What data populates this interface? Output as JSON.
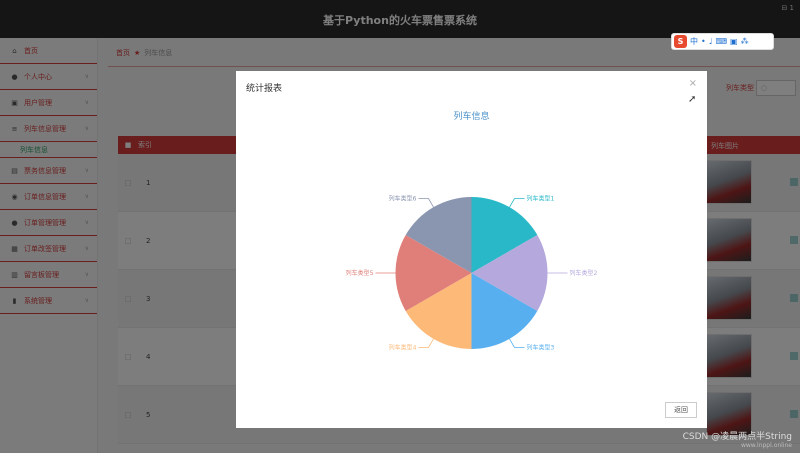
{
  "app": {
    "title": "基于Python的火车票售票系统",
    "top_right": "⊟ 1"
  },
  "sidebar": {
    "items": [
      {
        "label": "首页",
        "icon": "home-icon",
        "glyph": "⌂",
        "chevron": ""
      },
      {
        "label": "个人中心",
        "icon": "user-icon",
        "glyph": "●",
        "chevron": "∨"
      },
      {
        "label": "用户管理",
        "icon": "id-card-icon",
        "glyph": "▣",
        "chevron": "∨"
      },
      {
        "label": "列车信息管理",
        "icon": "list-icon",
        "glyph": "≡",
        "chevron": "∨"
      },
      {
        "label": "列车信息",
        "sub": true
      },
      {
        "label": "票务信息管理",
        "icon": "ticket-icon",
        "glyph": "▤",
        "chevron": "∨"
      },
      {
        "label": "订单信息管理",
        "icon": "lightbulb-icon",
        "glyph": "◉",
        "chevron": "∨"
      },
      {
        "label": "订单管理管理",
        "icon": "person-icon",
        "glyph": "●",
        "chevron": "∨"
      },
      {
        "label": "订单改签管理",
        "icon": "calendar-icon",
        "glyph": "▦",
        "chevron": "∨"
      },
      {
        "label": "留言板管理",
        "icon": "message-icon",
        "glyph": "▥",
        "chevron": "∨"
      },
      {
        "label": "系统管理",
        "icon": "chart-icon",
        "glyph": "▮",
        "chevron": "∨"
      }
    ]
  },
  "breadcrumb": {
    "home": "首页",
    "separator": "★",
    "current": "列车信息"
  },
  "search": {
    "label": "列车类型",
    "placeholder": "○"
  },
  "table": {
    "headers": {
      "checkbox": "■",
      "index": "索引",
      "image": "列车图片"
    },
    "rows": [
      {
        "index": "1"
      },
      {
        "index": "2"
      },
      {
        "index": "3"
      },
      {
        "index": "4"
      },
      {
        "index": "5"
      }
    ]
  },
  "dialog": {
    "title": "统计报表",
    "close": "×",
    "button": "返回"
  },
  "chart_data": {
    "type": "pie",
    "title": "列车信息",
    "categories": [
      "列车类型1",
      "列车类型2",
      "列车类型3",
      "列车类型4",
      "列车类型5",
      "列车类型6"
    ],
    "values": [
      1,
      1,
      1,
      1,
      1,
      1
    ],
    "colors": [
      "#28b8c8",
      "#b4a8dc",
      "#58aff0",
      "#fcb977",
      "#e07f7a",
      "#8a95b0"
    ]
  },
  "ime": {
    "chars": [
      "中",
      "•",
      "♩",
      "⌨",
      "▣",
      "⁂"
    ]
  },
  "watermark": {
    "line1": "CSDN @凌晨两点半String",
    "line2": "www.lnppl.online"
  }
}
